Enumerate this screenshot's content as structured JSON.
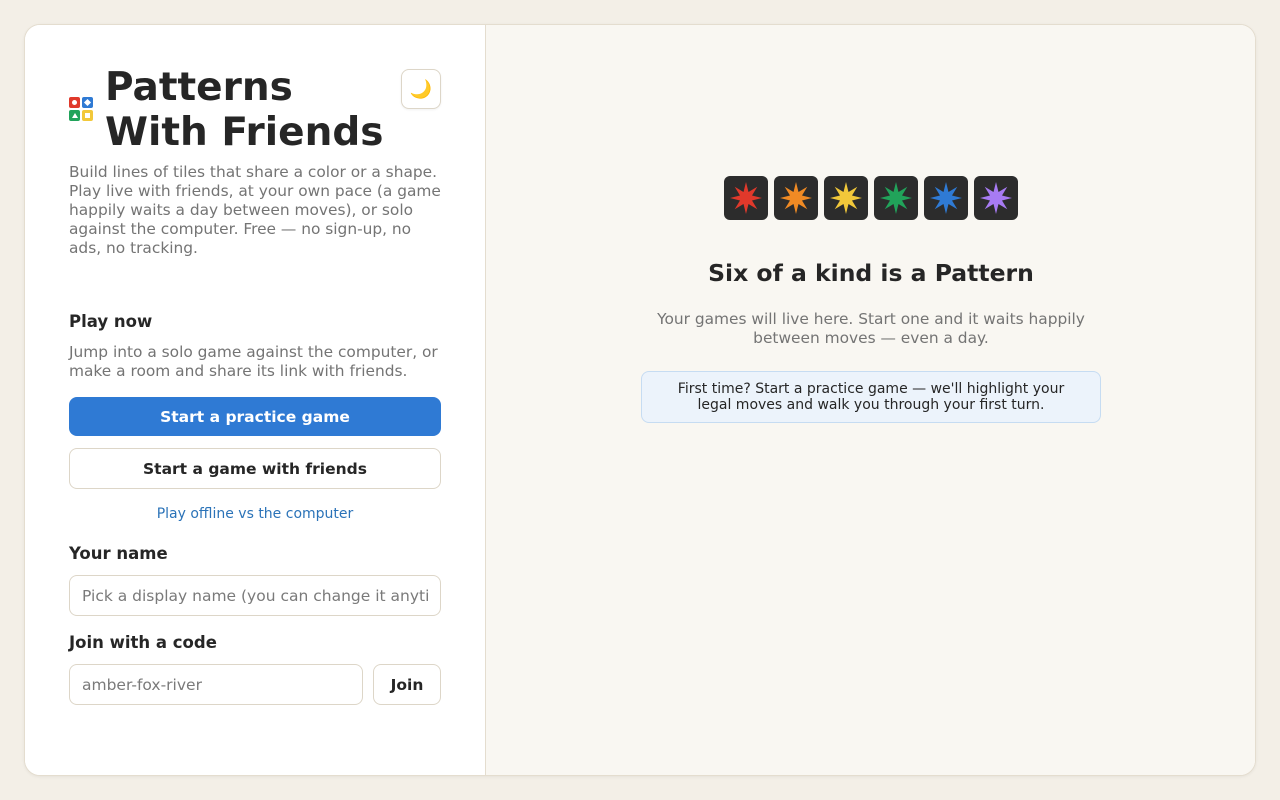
{
  "header": {
    "title": "Patterns With Friends",
    "theme_toggle_icon": "moon-icon"
  },
  "intro": {
    "tagline": "Build lines of tiles that share a color or a shape. Play live with friends, at your own pace (a game happily waits a day between moves), or solo against the computer. Free — no sign-up, no ads, no tracking."
  },
  "play": {
    "heading": "Play now",
    "description": "Jump into a solo game against the computer, or make a room and share its link with friends.",
    "practice_button": "Start a practice game",
    "friends_button": "Start a game with friends",
    "offline_link": "Play offline vs the computer"
  },
  "name": {
    "heading": "Your name",
    "placeholder": "Pick a display name (you can change it anytime)",
    "value": ""
  },
  "join": {
    "heading": "Join with a code",
    "placeholder": "amber-fox-river",
    "value": "",
    "button": "Join"
  },
  "empty_state": {
    "tiles": [
      {
        "shape": "starburst-icon",
        "color": "#e0392b"
      },
      {
        "shape": "starburst-icon",
        "color": "#f08a24"
      },
      {
        "shape": "starburst-icon",
        "color": "#f2c83a"
      },
      {
        "shape": "starburst-icon",
        "color": "#21a35a"
      },
      {
        "shape": "starburst-icon",
        "color": "#2f7ad4"
      },
      {
        "shape": "starburst-icon",
        "color": "#a77bf3"
      }
    ],
    "title": "Six of a kind is a Pattern",
    "subtitle": "Your games will live here. Start one and it waits happily between moves — even a day.",
    "hint": "First time? Start a practice game — we'll highlight your legal moves and walk you through your first turn."
  },
  "colors": {
    "accent": "#2f7ad4",
    "link": "#2b73b8",
    "background": "#f3efe7"
  }
}
